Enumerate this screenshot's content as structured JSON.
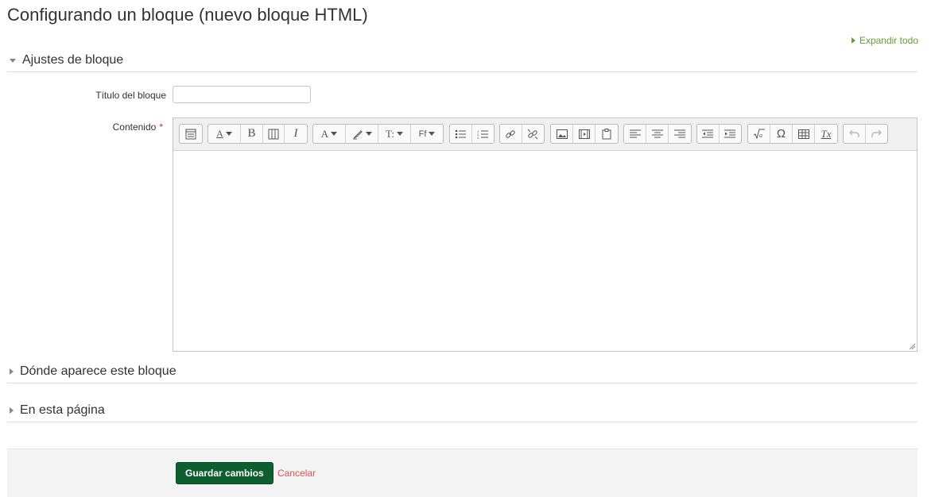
{
  "page": {
    "title": "Configurando un bloque (nuevo bloque HTML)",
    "expand_all": "Expandir todo"
  },
  "sections": {
    "block_settings": "Ajustes de bloque",
    "where_appears": "Dónde aparece este bloque",
    "on_this_page": "En esta página"
  },
  "form": {
    "title_label": "Título del bloque",
    "title_value": "",
    "content_label": "Contenido",
    "required_mark": "*",
    "content_value": ""
  },
  "toolbar": {
    "font_size_glyph": "A",
    "bold_glyph": "B",
    "italic_glyph": "I",
    "font_color_glyph": "A",
    "styles_glyph": "T:",
    "font_family_glyph": "Ff",
    "omega_glyph": "Ω",
    "clear_format_glyph": "Tx"
  },
  "actions": {
    "save_label": "Guardar cambios",
    "cancel_label": "Cancelar"
  },
  "colors": {
    "primary": "#0f5e30",
    "link_green": "#6a9a35",
    "cancel_red": "#d9534f",
    "required_red": "#c9302c"
  }
}
